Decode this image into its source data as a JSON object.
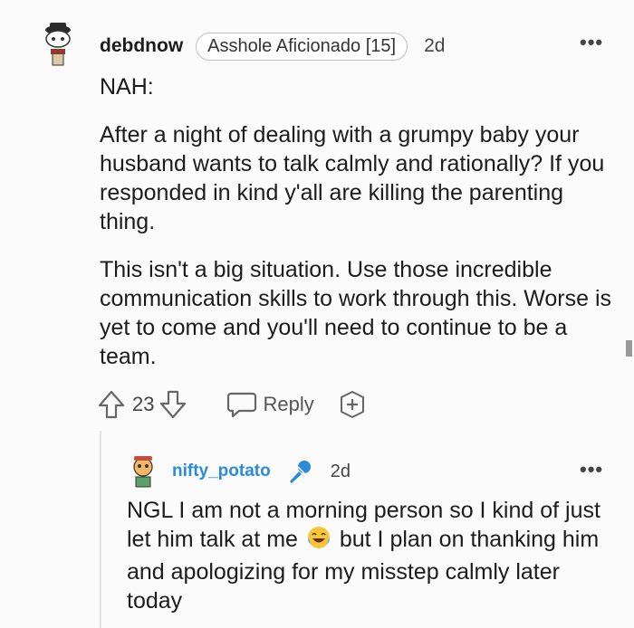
{
  "comment": {
    "username": "debdnow",
    "flair": "Asshole Aficionado [15]",
    "age": "2d",
    "more_label": "•••",
    "paragraphs": [
      "NAH:",
      "After a night of dealing with a grumpy baby your husband wants to talk calmly and rationally? If you responded in kind y'all are killing the parenting thing.",
      "This isn't a big situation. Use those incredible communication skills to work through this. Worse is yet to come and you'll need to continue to be a team."
    ],
    "votes": "23",
    "reply_label": "Reply"
  },
  "reply": {
    "username": "nifty_potato",
    "age": "2d",
    "more_label": "•••",
    "text_before_emoji": "NGL I am not a morning person so I kind of just let him talk at me",
    "text_after_emoji": "but I plan on thanking him and apologizing for my misstep calmly later today"
  },
  "colors": {
    "background": "#fbfbfb",
    "username_link": "#2a8bd6",
    "icon_gray": "#666666"
  }
}
